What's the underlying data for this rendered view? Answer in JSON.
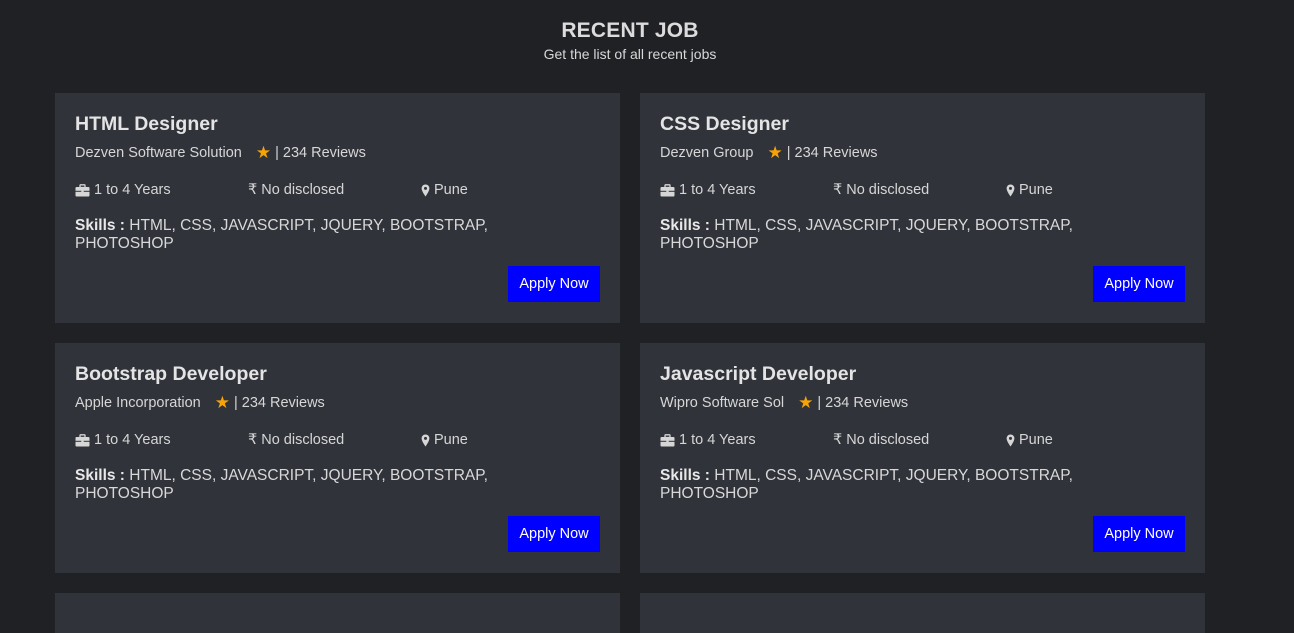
{
  "header": {
    "title": "RECENT JOB",
    "subtitle": "Get the list of all recent jobs"
  },
  "colors": {
    "background": "#202125",
    "card": "#30333a",
    "star": "#f6a30a",
    "apply_button": "#0000ff"
  },
  "icons": {
    "experience": "briefcase-icon",
    "salary": "rupee-icon",
    "location": "map-marker-icon",
    "rating": "star-icon"
  },
  "jobs": [
    {
      "title": "HTML Designer",
      "company": "Dezven Software Solution",
      "reviews": "| 234 Reviews",
      "experience": "1 to 4 Years",
      "salary": "No disclosed",
      "location": "Pune",
      "skills_label": "Skills :",
      "skills": "HTML, CSS, JAVASCRIPT, JQUERY, BOOTSTRAP, PHOTOSHOP",
      "apply_label": "Apply Now"
    },
    {
      "title": "CSS Designer",
      "company": "Dezven Group",
      "reviews": "| 234 Reviews",
      "experience": "1 to 4 Years",
      "salary": "No disclosed",
      "location": "Pune",
      "skills_label": "Skills :",
      "skills": "HTML, CSS, JAVASCRIPT, JQUERY, BOOTSTRAP, PHOTOSHOP",
      "apply_label": "Apply Now"
    },
    {
      "title": "Bootstrap Developer",
      "company": "Apple Incorporation",
      "reviews": "| 234 Reviews",
      "experience": "1 to 4 Years",
      "salary": "No disclosed",
      "location": "Pune",
      "skills_label": "Skills :",
      "skills": "HTML, CSS, JAVASCRIPT, JQUERY, BOOTSTRAP, PHOTOSHOP",
      "apply_label": "Apply Now"
    },
    {
      "title": "Javascript Developer",
      "company": "Wipro Software Sol",
      "reviews": "| 234 Reviews",
      "experience": "1 to 4 Years",
      "salary": "No disclosed",
      "location": "Pune",
      "skills_label": "Skills :",
      "skills": "HTML, CSS, JAVASCRIPT, JQUERY, BOOTSTRAP, PHOTOSHOP",
      "apply_label": "Apply Now"
    }
  ]
}
